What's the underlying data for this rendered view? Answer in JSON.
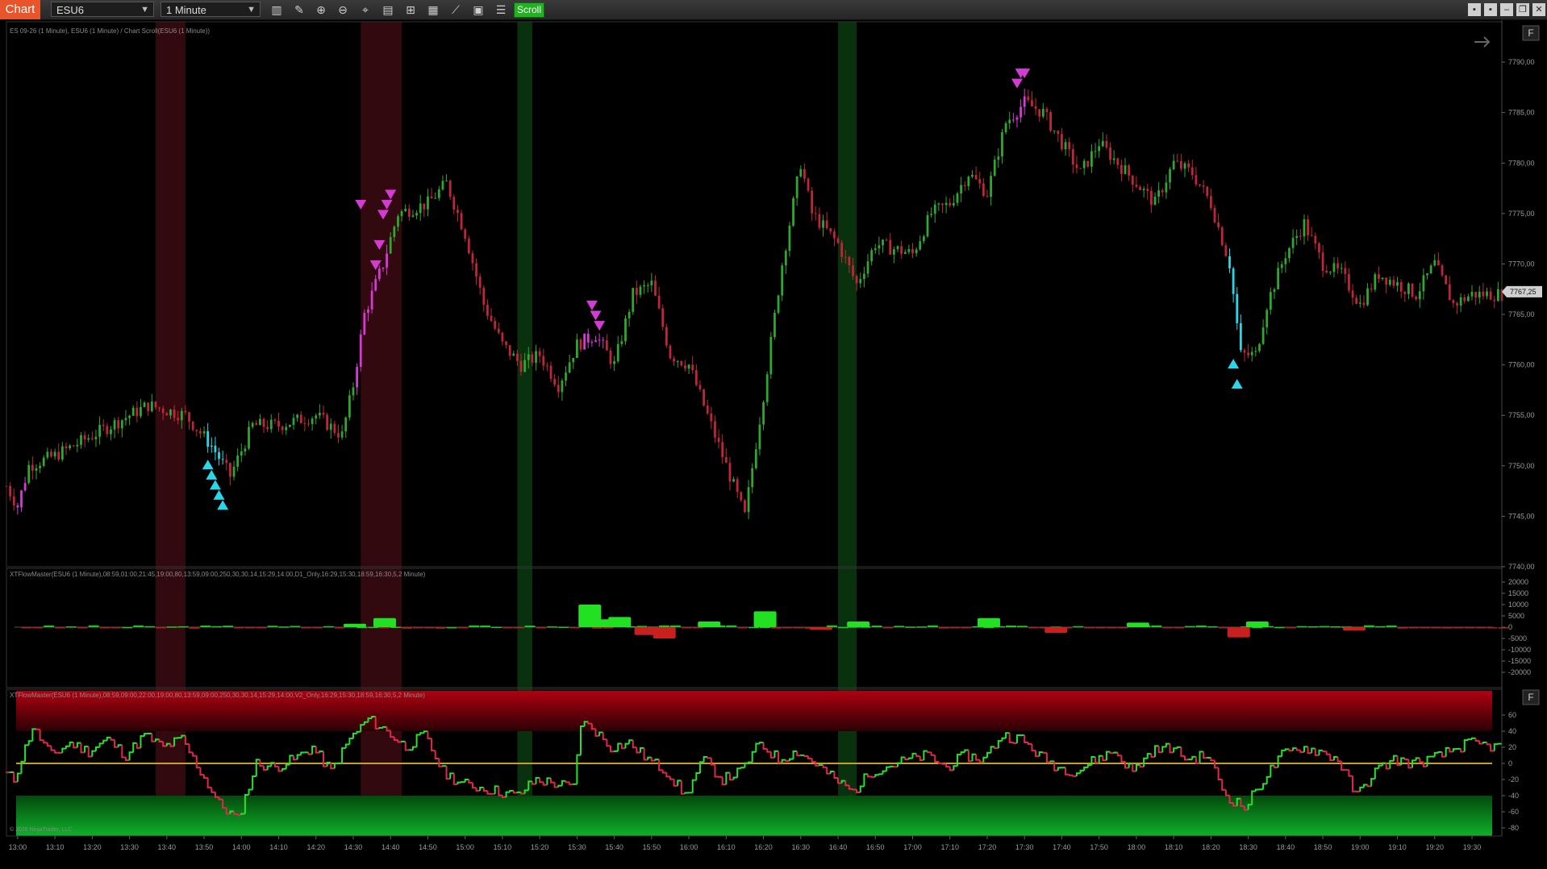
{
  "toolbar": {
    "tab_label": "Chart",
    "instrument": "ESU6",
    "interval": "1 Minute",
    "scroll_label": "Scroll",
    "tools": [
      "bars-icon",
      "pencil-icon",
      "zoom-in-icon",
      "zoom-out-icon",
      "crosshair-icon",
      "properties-icon",
      "strategy-icon",
      "data-box-icon",
      "drawing-tool-icon",
      "templates-icon",
      "list-icon"
    ]
  },
  "price_panel": {
    "label": "ES 09-26 (1 Minute), ESU6 (1 Minute) / Chart Scroll(ESU6 (1 Minute))",
    "y_ticks": [
      "7790,00",
      "7785,00",
      "7780,00",
      "7775,00",
      "7770,00",
      "7765,00",
      "7760,00",
      "7755,00",
      "7750,00",
      "7745,00",
      "7740,00"
    ],
    "current_price": "7767,25",
    "corner_button": "F"
  },
  "flow_panel": {
    "label": "XTFlowMaster(ESU6 (1 Minute),08:59,01:00,21:45,19:00,80,13:59,09:00,250,30,30,14,15:29,14:00,D1_Only,16:29,15:30,18:59,16:30,5,2 Minute)",
    "y_ticks": [
      "20000",
      "15000",
      "10000",
      "5000",
      "0",
      "-5000",
      "-10000",
      "-15000",
      "-20000"
    ]
  },
  "osc_panel": {
    "label": "XTFlowMaster(ESU6 (1 Minute),08:59,09:00,22:00,19:00,80,13:59,09:00,250,30,30,14,15:29,14:00,V2_Only,16:29,15:30,18:59,16:30,5,2 Minute)",
    "y_ticks": [
      "60",
      "40",
      "20",
      "0",
      "-20",
      "-40",
      "-60",
      "-80"
    ],
    "corner_button": "F",
    "copyright": "© 2026 NinjaTrader, LLC"
  },
  "x_ticks": [
    "13:00",
    "13:10",
    "13:20",
    "13:30",
    "13:40",
    "13:50",
    "14:00",
    "14:10",
    "14:20",
    "14:30",
    "14:40",
    "14:50",
    "15:00",
    "15:10",
    "15:20",
    "15:30",
    "15:40",
    "15:50",
    "16:00",
    "16:10",
    "16:20",
    "16:30",
    "16:40",
    "16:50",
    "17:00",
    "17:10",
    "17:20",
    "17:30",
    "17:40",
    "17:50",
    "18:00",
    "18:10",
    "18:20",
    "18:30",
    "18:40",
    "18:50",
    "19:00",
    "19:10",
    "19:20",
    "19:30"
  ],
  "colors": {
    "up": "#2fa82f",
    "down": "#c0263a",
    "magenta": "#d63ad6",
    "cyan": "#28d8e8",
    "zone_red": "#3a0a12",
    "zone_green": "#0c3a10",
    "zero_line": "#c8a020",
    "bar_green": "#22e022",
    "bar_red": "#c81f1f"
  },
  "chart_data": {
    "type": "candlestick",
    "x_range": [
      "12:57",
      "19:38"
    ],
    "price_range": [
      7740,
      7794
    ],
    "price_path": [
      [
        "12:57",
        7748
      ],
      [
        "13:00",
        7746
      ],
      [
        "13:03",
        7750
      ],
      [
        "13:10",
        7751
      ],
      [
        "13:20",
        7753
      ],
      [
        "13:30",
        7755
      ],
      [
        "13:35",
        7756
      ],
      [
        "13:45",
        7755
      ],
      [
        "13:52",
        7752
      ],
      [
        "13:57",
        7749
      ],
      [
        "14:03",
        7754
      ],
      [
        "14:10",
        7754
      ],
      [
        "14:20",
        7755
      ],
      [
        "14:27",
        7753
      ],
      [
        "14:30",
        7758
      ],
      [
        "14:33",
        7765
      ],
      [
        "14:38",
        7770
      ],
      [
        "14:42",
        7775
      ],
      [
        "14:50",
        7776
      ],
      [
        "14:55",
        7778
      ],
      [
        "15:00",
        7773
      ],
      [
        "15:05",
        7766
      ],
      [
        "15:10",
        7762
      ],
      [
        "15:15",
        7760
      ],
      [
        "15:20",
        7761
      ],
      [
        "15:25",
        7758
      ],
      [
        "15:30",
        7762
      ],
      [
        "15:35",
        7763
      ],
      [
        "15:40",
        7760
      ],
      [
        "15:45",
        7767
      ],
      [
        "15:50",
        7768
      ],
      [
        "15:55",
        7761
      ],
      [
        "16:00",
        7760
      ],
      [
        "16:05",
        7755
      ],
      [
        "16:10",
        7750
      ],
      [
        "16:15",
        7745
      ],
      [
        "16:20",
        7757
      ],
      [
        "16:25",
        7770
      ],
      [
        "16:30",
        7780
      ],
      [
        "16:33",
        7775
      ],
      [
        "16:40",
        7772
      ],
      [
        "16:45",
        7768
      ],
      [
        "16:50",
        7772
      ],
      [
        "17:00",
        7771
      ],
      [
        "17:05",
        7775
      ],
      [
        "17:10",
        7776
      ],
      [
        "17:15",
        7779
      ],
      [
        "17:20",
        7777
      ],
      [
        "17:25",
        7784
      ],
      [
        "17:30",
        7786
      ],
      [
        "17:35",
        7785
      ],
      [
        "17:40",
        7782
      ],
      [
        "17:45",
        7779
      ],
      [
        "17:50",
        7782
      ],
      [
        "17:55",
        7780
      ],
      [
        "18:00",
        7778
      ],
      [
        "18:05",
        7776
      ],
      [
        "18:10",
        7780
      ],
      [
        "18:15",
        7779
      ],
      [
        "18:20",
        7776
      ],
      [
        "18:25",
        7770
      ],
      [
        "18:28",
        7761
      ],
      [
        "18:32",
        7761
      ],
      [
        "18:35",
        7766
      ],
      [
        "18:40",
        7771
      ],
      [
        "18:45",
        7774
      ],
      [
        "18:50",
        7770
      ],
      [
        "18:55",
        7769
      ],
      [
        "19:00",
        7766
      ],
      [
        "19:05",
        7769
      ],
      [
        "19:10",
        7768
      ],
      [
        "19:15",
        7767
      ],
      [
        "19:20",
        7770
      ],
      [
        "19:25",
        7766
      ],
      [
        "19:30",
        7767
      ],
      [
        "19:38",
        7767
      ]
    ],
    "shaded_zones": [
      {
        "from": "13:37",
        "to": "13:45",
        "kind": "red"
      },
      {
        "from": "14:32",
        "to": "14:43",
        "kind": "red"
      },
      {
        "from": "15:14",
        "to": "15:18",
        "kind": "green"
      },
      {
        "from": "16:40",
        "to": "16:45",
        "kind": "green"
      }
    ],
    "sell_signals": [
      {
        "time": "14:32",
        "price": 7775
      },
      {
        "time": "14:36",
        "price": 7769
      },
      {
        "time": "14:37",
        "price": 7771
      },
      {
        "time": "14:38",
        "price": 7774
      },
      {
        "time": "14:39",
        "price": 7775
      },
      {
        "time": "14:40",
        "price": 7776
      },
      {
        "time": "15:34",
        "price": 7765
      },
      {
        "time": "15:35",
        "price": 7764
      },
      {
        "time": "15:36",
        "price": 7763
      },
      {
        "time": "17:28",
        "price": 7787
      },
      {
        "time": "17:29",
        "price": 7788
      },
      {
        "time": "17:30",
        "price": 7788
      }
    ],
    "buy_signals": [
      {
        "time": "13:51",
        "price": 7751
      },
      {
        "time": "13:52",
        "price": 7750
      },
      {
        "time": "13:53",
        "price": 7749
      },
      {
        "time": "13:54",
        "price": 7748
      },
      {
        "time": "13:55",
        "price": 7747
      },
      {
        "time": "18:26",
        "price": 7761
      },
      {
        "time": "18:27",
        "price": 7759
      }
    ],
    "flow_bars": [
      {
        "time": "14:30",
        "value": 1500
      },
      {
        "time": "14:38",
        "value": 4000
      },
      {
        "time": "15:33",
        "value": 10000
      },
      {
        "time": "15:37",
        "value": 3500
      },
      {
        "time": "15:41",
        "value": 4500
      },
      {
        "time": "15:48",
        "value": -3500
      },
      {
        "time": "15:53",
        "value": -5000
      },
      {
        "time": "16:05",
        "value": 2500
      },
      {
        "time": "16:20",
        "value": 7000
      },
      {
        "time": "16:35",
        "value": -1200
      },
      {
        "time": "16:45",
        "value": 2500
      },
      {
        "time": "17:20",
        "value": 4000
      },
      {
        "time": "17:38",
        "value": -2500
      },
      {
        "time": "18:00",
        "value": 2000
      },
      {
        "time": "18:27",
        "value": -4500
      },
      {
        "time": "18:32",
        "value": 2500
      },
      {
        "time": "18:58",
        "value": -1500
      }
    ],
    "osc_range": [
      -90,
      90
    ],
    "osc_path": [
      [
        "12:57",
        -10
      ],
      [
        "13:00",
        -20
      ],
      [
        "13:05",
        45
      ],
      [
        "13:10",
        10
      ],
      [
        "13:15",
        25
      ],
      [
        "13:20",
        15
      ],
      [
        "13:25",
        30
      ],
      [
        "13:30",
        10
      ],
      [
        "13:35",
        35
      ],
      [
        "13:40",
        20
      ],
      [
        "13:45",
        30
      ],
      [
        "13:50",
        -10
      ],
      [
        "13:55",
        -50
      ],
      [
        "14:00",
        -70
      ],
      [
        "14:05",
        0
      ],
      [
        "14:10",
        -5
      ],
      [
        "14:15",
        5
      ],
      [
        "14:20",
        20
      ],
      [
        "14:25",
        -10
      ],
      [
        "14:30",
        30
      ],
      [
        "14:35",
        55
      ],
      [
        "14:40",
        40
      ],
      [
        "14:45",
        20
      ],
      [
        "14:50",
        35
      ],
      [
        "14:55",
        -10
      ],
      [
        "15:00",
        -25
      ],
      [
        "15:05",
        -30
      ],
      [
        "15:10",
        -35
      ],
      [
        "15:15",
        -40
      ],
      [
        "15:20",
        -20
      ],
      [
        "15:25",
        -25
      ],
      [
        "15:30",
        -30
      ],
      [
        "15:32",
        50
      ],
      [
        "15:35",
        45
      ],
      [
        "15:40",
        20
      ],
      [
        "15:45",
        25
      ],
      [
        "15:50",
        5
      ],
      [
        "15:55",
        -10
      ],
      [
        "16:00",
        -40
      ],
      [
        "16:05",
        5
      ],
      [
        "16:10",
        -20
      ],
      [
        "16:15",
        -10
      ],
      [
        "16:20",
        25
      ],
      [
        "16:25",
        5
      ],
      [
        "16:30",
        15
      ],
      [
        "16:35",
        0
      ],
      [
        "16:40",
        -20
      ],
      [
        "16:45",
        -35
      ],
      [
        "16:50",
        -10
      ],
      [
        "17:00",
        5
      ],
      [
        "17:05",
        10
      ],
      [
        "17:10",
        -5
      ],
      [
        "17:15",
        10
      ],
      [
        "17:20",
        5
      ],
      [
        "17:25",
        35
      ],
      [
        "17:30",
        30
      ],
      [
        "17:35",
        10
      ],
      [
        "17:40",
        -5
      ],
      [
        "17:45",
        -10
      ],
      [
        "17:50",
        5
      ],
      [
        "17:55",
        15
      ],
      [
        "18:00",
        -10
      ],
      [
        "18:05",
        15
      ],
      [
        "18:10",
        20
      ],
      [
        "18:15",
        5
      ],
      [
        "18:20",
        10
      ],
      [
        "18:25",
        -40
      ],
      [
        "18:30",
        -55
      ],
      [
        "18:35",
        -20
      ],
      [
        "18:40",
        10
      ],
      [
        "18:45",
        20
      ],
      [
        "18:50",
        15
      ],
      [
        "18:55",
        5
      ],
      [
        "19:00",
        -40
      ],
      [
        "19:05",
        -10
      ],
      [
        "19:10",
        5
      ],
      [
        "19:15",
        0
      ],
      [
        "19:20",
        5
      ],
      [
        "19:25",
        15
      ],
      [
        "19:30",
        25
      ],
      [
        "19:38",
        20
      ]
    ]
  }
}
